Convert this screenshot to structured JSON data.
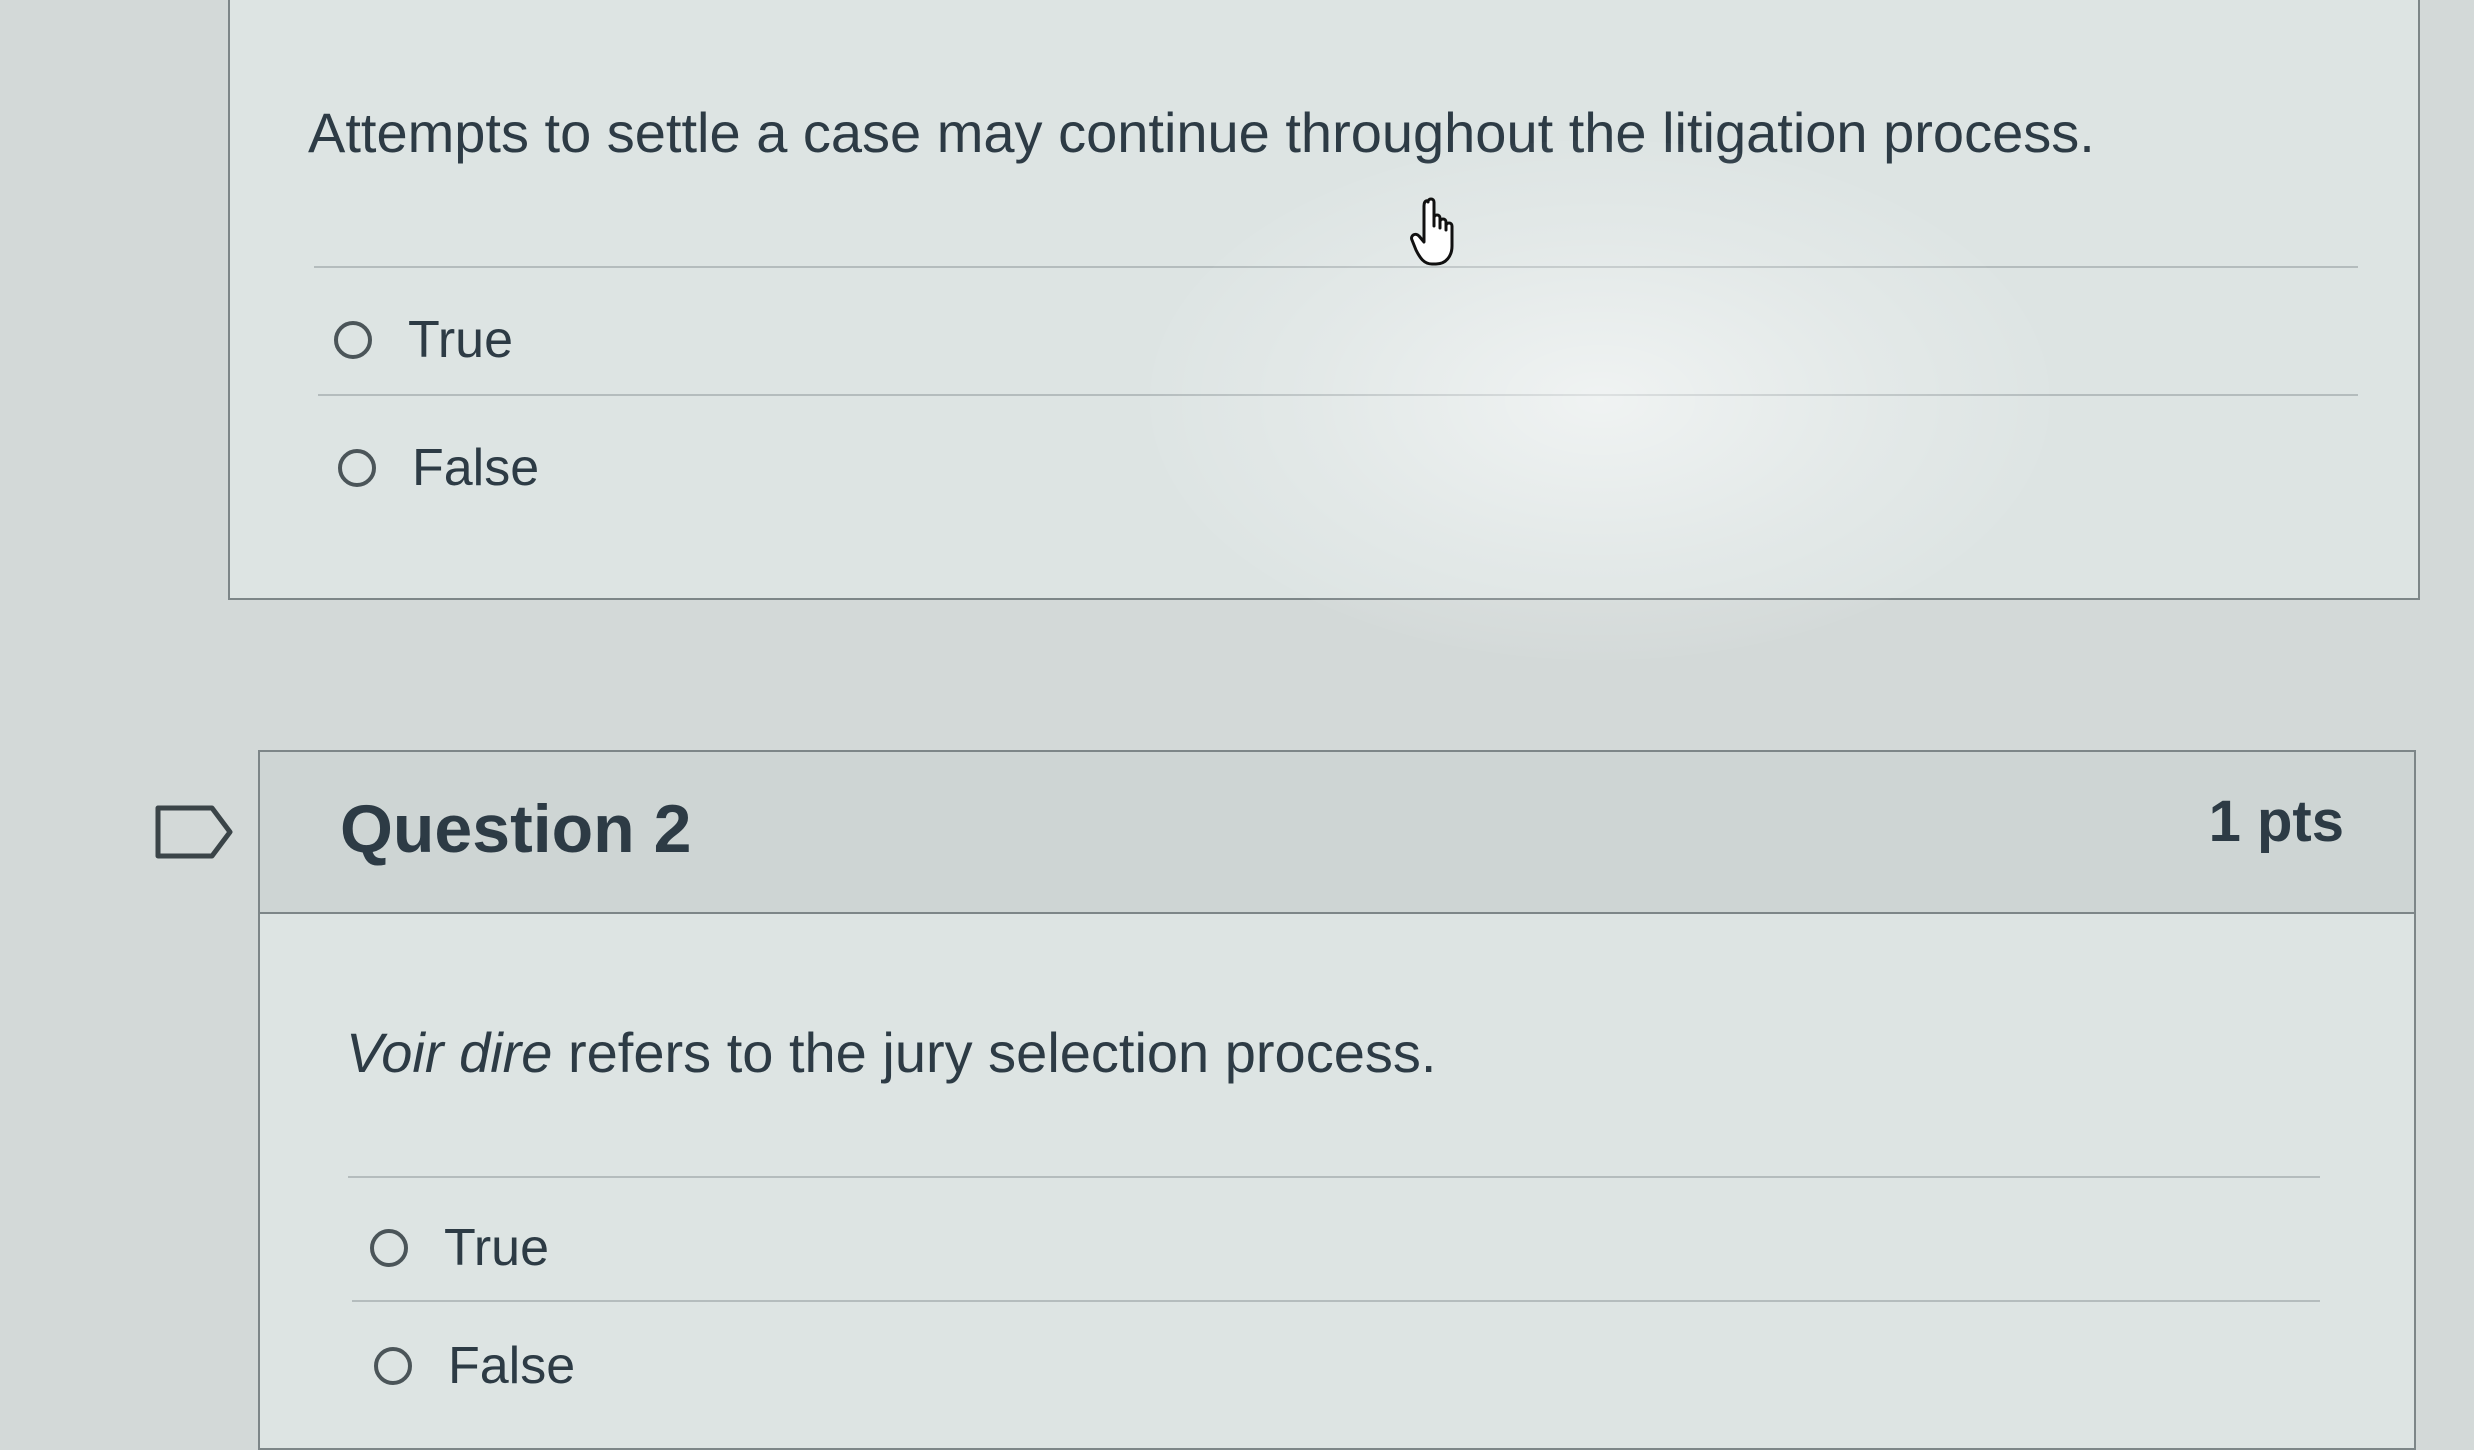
{
  "question_1": {
    "text": "Attempts to settle a case may continue throughout the litigation process.",
    "answers": [
      {
        "label": "True"
      },
      {
        "label": "False"
      }
    ]
  },
  "question_2": {
    "title": "Question 2",
    "points": "1 pts",
    "text_italic": "Voir dire",
    "text_rest": " refers to the jury selection process.",
    "answers": [
      {
        "label": "True"
      },
      {
        "label": "False"
      }
    ]
  },
  "icons": {
    "flag": "flag-question-icon",
    "cursor": "hand-pointer-icon"
  },
  "colors": {
    "background": "#d3d9d8",
    "card": "#dde4e3",
    "header": "#ced5d4",
    "text": "#2d3b45",
    "border": "#7d8688"
  }
}
